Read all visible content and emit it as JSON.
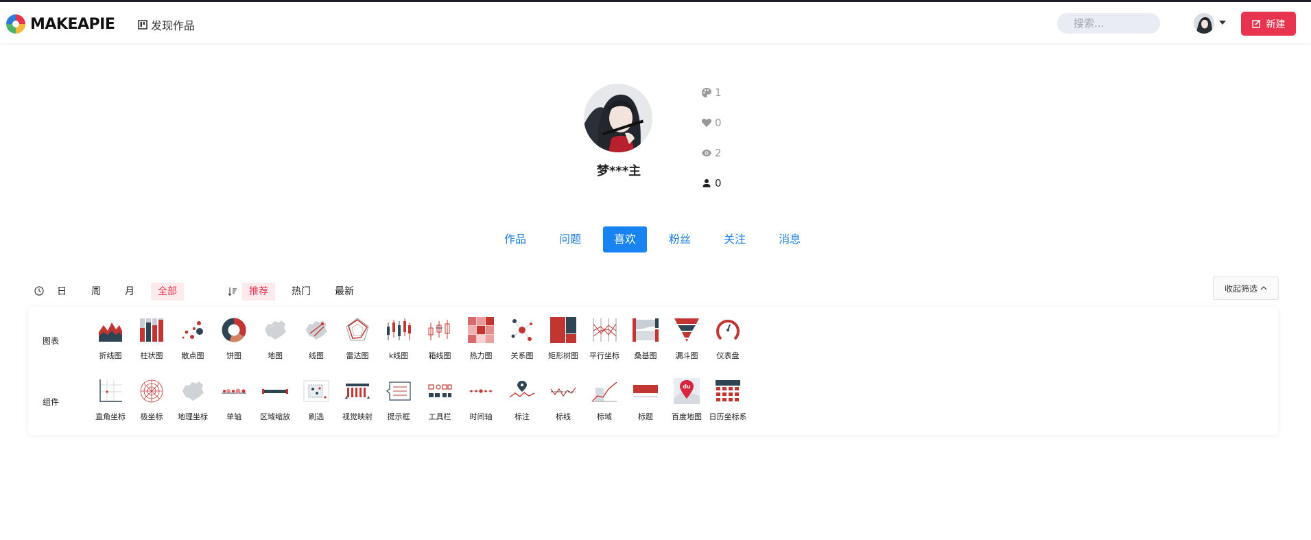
{
  "brand": {
    "name": "MAKEAPIE"
  },
  "nav": {
    "discover": "发现作品"
  },
  "search": {
    "placeholder": "搜索..."
  },
  "actions": {
    "new_label": "新建"
  },
  "profile": {
    "username": "梦***主",
    "stats": {
      "works": "1",
      "likes": "0",
      "views": "2",
      "followers": "0"
    }
  },
  "tabs": [
    "作品",
    "问题",
    "喜欢",
    "粉丝",
    "关注",
    "消息"
  ],
  "active_tab": "喜欢",
  "filters": {
    "time": [
      "日",
      "周",
      "月",
      "全部"
    ],
    "time_active": "全部",
    "sort": [
      "推荐",
      "热门",
      "最新"
    ],
    "sort_active": "推荐",
    "collapse_label": "收起筛选"
  },
  "categories": {
    "charts_label": "图表",
    "components_label": "组件",
    "charts": [
      "折线图",
      "柱状图",
      "散点图",
      "饼图",
      "地图",
      "线图",
      "雷达图",
      "k线图",
      "箱线图",
      "热力图",
      "关系图",
      "矩形树图",
      "平行坐标",
      "桑基图",
      "漏斗图",
      "仪表盘"
    ],
    "components": [
      "直角坐标",
      "极坐标",
      "地理坐标",
      "单轴",
      "区域缩放",
      "刷选",
      "视觉映射",
      "提示框",
      "工具栏",
      "时间轴",
      "标注",
      "标线",
      "标域",
      "标题",
      "百度地图",
      "日历坐标系"
    ],
    "thumb_badge": "du"
  },
  "colors": {
    "accent": "#e8344e",
    "primary": "#1784f2",
    "navy": "#2b3a55"
  }
}
